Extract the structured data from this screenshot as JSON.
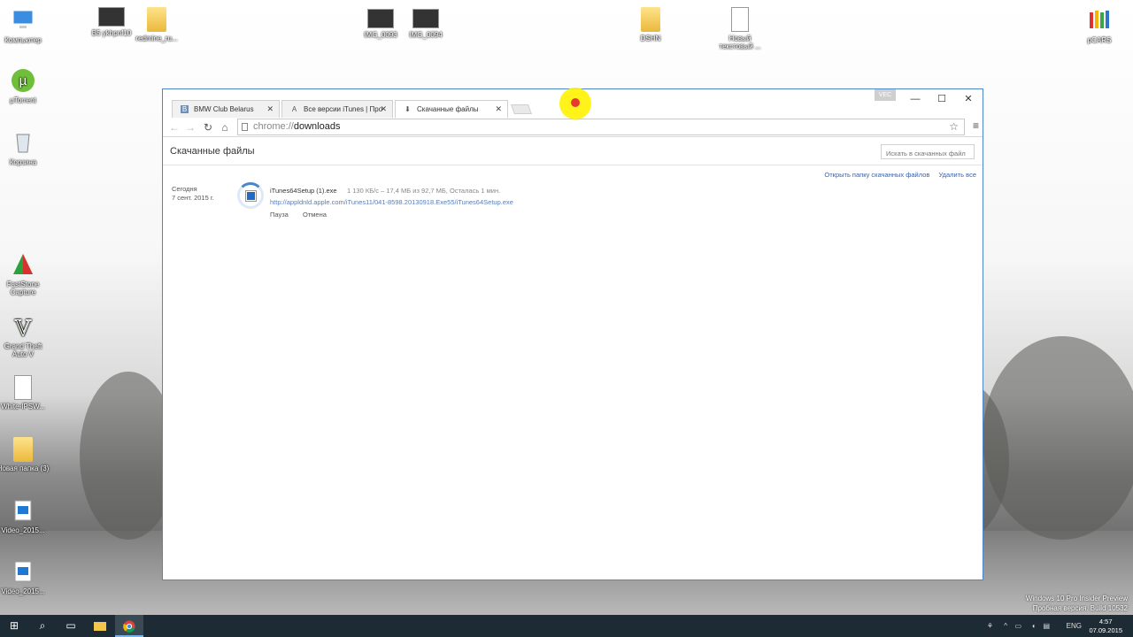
{
  "desktop": {
    "icons": [
      {
        "label": "Компьютер",
        "icon": "computer-icon"
      },
      {
        "label": "B5 ykhpnf10",
        "icon": "image-thumb-icon"
      },
      {
        "label": "redmine_ru...",
        "icon": "folder-icon"
      },
      {
        "label": "IMG_0093",
        "icon": "image-thumb-icon"
      },
      {
        "label": "IMG_0094",
        "icon": "image-thumb-icon"
      },
      {
        "label": "DSHN",
        "icon": "folder-icon"
      },
      {
        "label": "Новый текстовый ...",
        "icon": "text-document-icon"
      },
      {
        "label": "pCARS",
        "icon": "pcars-icon"
      },
      {
        "label": "µTorrent",
        "icon": "utorrent-icon"
      },
      {
        "label": "Корзина",
        "icon": "recycle-bin-icon"
      },
      {
        "label": "FastStone Capture",
        "icon": "faststone-icon"
      },
      {
        "label": "Grand Theft Auto V",
        "icon": "gta-v-icon"
      },
      {
        "label": "White-IPSW...",
        "icon": "ipsw-file-icon"
      },
      {
        "label": "Новая папка (3)",
        "icon": "folder-icon"
      },
      {
        "label": "Video_2015...",
        "icon": "video-file-icon"
      },
      {
        "label": "Video_2015...",
        "icon": "video-file-icon"
      }
    ]
  },
  "browser": {
    "tabs": [
      {
        "label": "BMW Club Belarus",
        "icon": "vk-icon",
        "active": false
      },
      {
        "label": "Все версии iTunes | Про",
        "icon": "site-a-icon",
        "active": false
      },
      {
        "label": "Скачанные файлы",
        "icon": "download-icon",
        "active": true
      }
    ],
    "user_badge": "VEC",
    "url_scheme": "chrome://",
    "url_path": "downloads",
    "page_title": "Скачанные файлы",
    "search_placeholder": "Искать в скачанных файл",
    "actions": {
      "open_folder": "Открыть папку скачанных файлов",
      "clear_all": "Удалить все"
    },
    "download": {
      "date_label": "Сегодня",
      "date": "7 сент. 2015 г.",
      "filename": "iTunes64Setup (1).exe",
      "status": "1 130 КБ/с – 17,4 МБ из 92,7 МБ, Осталась 1 мин.",
      "url": "http://appldnld.apple.com/iTunes11/041-8598.20130918.Exe55/iTunes64Setup.exe",
      "pause_label": "Пауза",
      "cancel_label": "Отмена",
      "progress": 0.19
    }
  },
  "taskbar": {
    "language": "ENG",
    "time": "4:57",
    "date": "07.09.2015"
  },
  "watermark": {
    "line1": "Windows 10 Pro Insider Preview",
    "line2": "Пробная версия. Build 10532"
  },
  "colors": {
    "accent": "#4a87c8",
    "link": "#3a5fa8",
    "taskbar": "#1d2b34"
  }
}
